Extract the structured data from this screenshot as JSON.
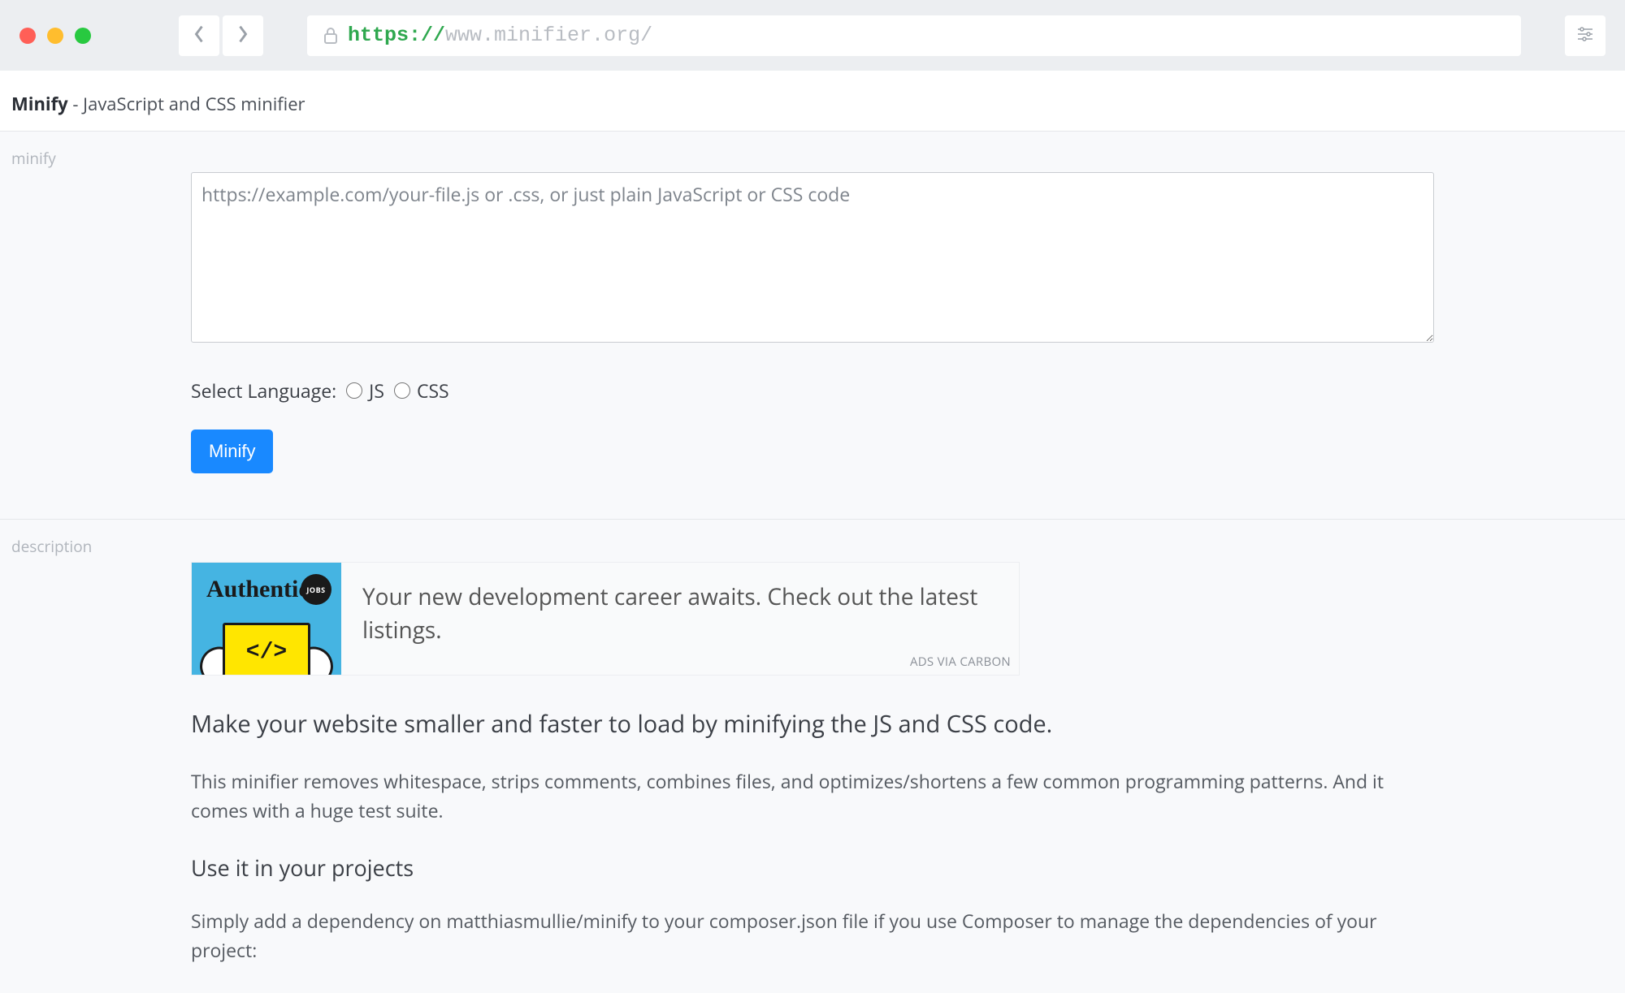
{
  "chrome": {
    "url_protocol": "https://",
    "url_rest": "www.minifier.org/"
  },
  "header": {
    "brand": "Minify",
    "tagline": " - JavaScript and CSS minifier"
  },
  "sections": {
    "minify": {
      "label": "minify",
      "textarea_placeholder": "https://example.com/your-file.js or .css, or just plain JavaScript or CSS code",
      "lang_prompt": "Select Language:",
      "lang_js": "JS",
      "lang_css": "CSS",
      "button_label": "Minify"
    },
    "description": {
      "label": "description",
      "ad": {
        "logo_text": "Authentic",
        "badge_text": "JOBS",
        "code_glyph": "</>",
        "copy": "Your new development career awaits. Check out the latest listings.",
        "via": "ADS VIA CARBON"
      },
      "heading": "Make your website smaller and faster to load by minifying the JS and CSS code.",
      "para1": "This minifier removes whitespace, strips comments, combines files, and optimizes/shortens a few common programming patterns. And it comes with a huge test suite.",
      "subheading": "Use it in your projects",
      "para2": "Simply add a dependency on matthiasmullie/minify to your composer.json file if you use Composer to manage the dependencies of your project:"
    }
  }
}
